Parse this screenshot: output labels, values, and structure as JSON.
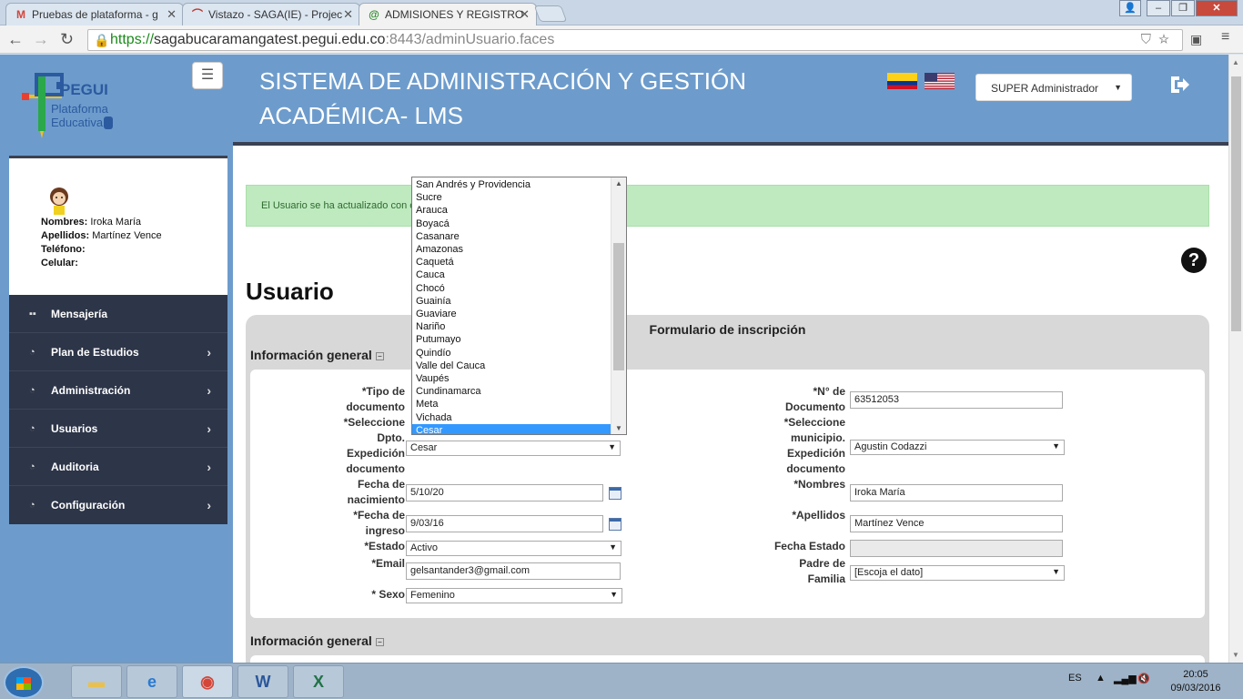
{
  "browser": {
    "tabs": [
      {
        "label": "Pruebas de plataforma - g",
        "icon": "gmail-icon"
      },
      {
        "label": "Vistazo - SAGA(IE) - Projec",
        "icon": "project-icon"
      },
      {
        "label": "ADMISIONES Y REGISTRO",
        "icon": "at-icon"
      }
    ],
    "url_scheme": "https://",
    "url_host": "sagabucaramangatest.pegui.edu.co",
    "url_rest": ":8443/adminUsuario.faces"
  },
  "header": {
    "title_line1": "SISTEMA DE ADMINISTRACIÓN Y GESTIÓN",
    "title_line2": "ACADÉMICA- LMS",
    "role": "SUPER Administrador",
    "logo_text_1": "PEGUI",
    "logo_text_2": "Plataforma",
    "logo_text_3": "Educativa"
  },
  "profile": {
    "nombres_label": "Nombres:",
    "nombres": "Iroka María",
    "apellidos_label": "Apellidos:",
    "apellidos": "Martínez Vence",
    "telefono_label": "Teléfono:",
    "celular_label": "Celular:"
  },
  "sidebar": {
    "items": [
      {
        "label": "Mensajería"
      },
      {
        "label": "Plan de Estudios"
      },
      {
        "label": "Administración"
      },
      {
        "label": "Usuarios"
      },
      {
        "label": "Auditoria"
      },
      {
        "label": "Configuración"
      }
    ]
  },
  "main": {
    "alert": "El Usuario se ha actualizado con é",
    "page_title": "Usuario",
    "panel_title": "Formulario de inscripción",
    "section1": "Información general",
    "section2": "Información general"
  },
  "form": {
    "tipo_doc_label_1": "*Tipo de",
    "tipo_doc_label_2": "documento",
    "dpto_label_1": "*Seleccione",
    "dpto_label_2": "Dpto.",
    "dpto_label_3": "Expedición",
    "dpto_label_4": "documento",
    "dpto_value": "Cesar",
    "fecha_nac_label_1": "Fecha de",
    "fecha_nac_label_2": "nacimiento",
    "fecha_nac_value": "5/10/20",
    "fecha_ing_label_1": "*Fecha de",
    "fecha_ing_label_2": "ingreso",
    "fecha_ing_value": "9/03/16",
    "estado_label": "*Estado",
    "estado_value": "Activo",
    "email_label": "*Email",
    "email_value": "gelsantander3@gmail.com",
    "sexo_label": "* Sexo",
    "sexo_value": "Femenino",
    "num_doc_label_1": "*N° de",
    "num_doc_label_2": "Documento",
    "num_doc_value": "63512053",
    "mun_label_1": "*Seleccione",
    "mun_label_2": "municipio.",
    "mun_label_3": "Expedición",
    "mun_label_4": "documento",
    "mun_value": "Agustin Codazzi",
    "nombres_label": "*Nombres",
    "nombres_value": "Iroka María",
    "apellidos_label": "*Apellidos",
    "apellidos_value": "Martínez Vence",
    "fecha_estado_label": "Fecha Estado",
    "fecha_estado_value": "",
    "padre_label_1": "Padre de",
    "padre_label_2": "Familia",
    "padre_value": "[Escoja el dato]"
  },
  "dropdown": {
    "options": [
      "San Andrés y Providencia",
      "Sucre",
      "Arauca",
      "Boyacá",
      "Casanare",
      "Amazonas",
      "Caquetá",
      "Cauca",
      "Chocó",
      "Guainía",
      "Guaviare",
      "Nariño",
      "Putumayo",
      "Quindío",
      "Valle del Cauca",
      "Vaupés",
      "Cundinamarca",
      "Meta",
      "Vichada",
      "Cesar"
    ],
    "highlighted": "Cesar"
  },
  "taskbar": {
    "lang": "ES",
    "time": "20:05",
    "date": "09/03/2016"
  },
  "colors": {
    "header_blue": "#6d9ccc",
    "sidebar_dark": "#2d3548",
    "alert_green": "#bfeac0",
    "highlight": "#3399ff"
  }
}
